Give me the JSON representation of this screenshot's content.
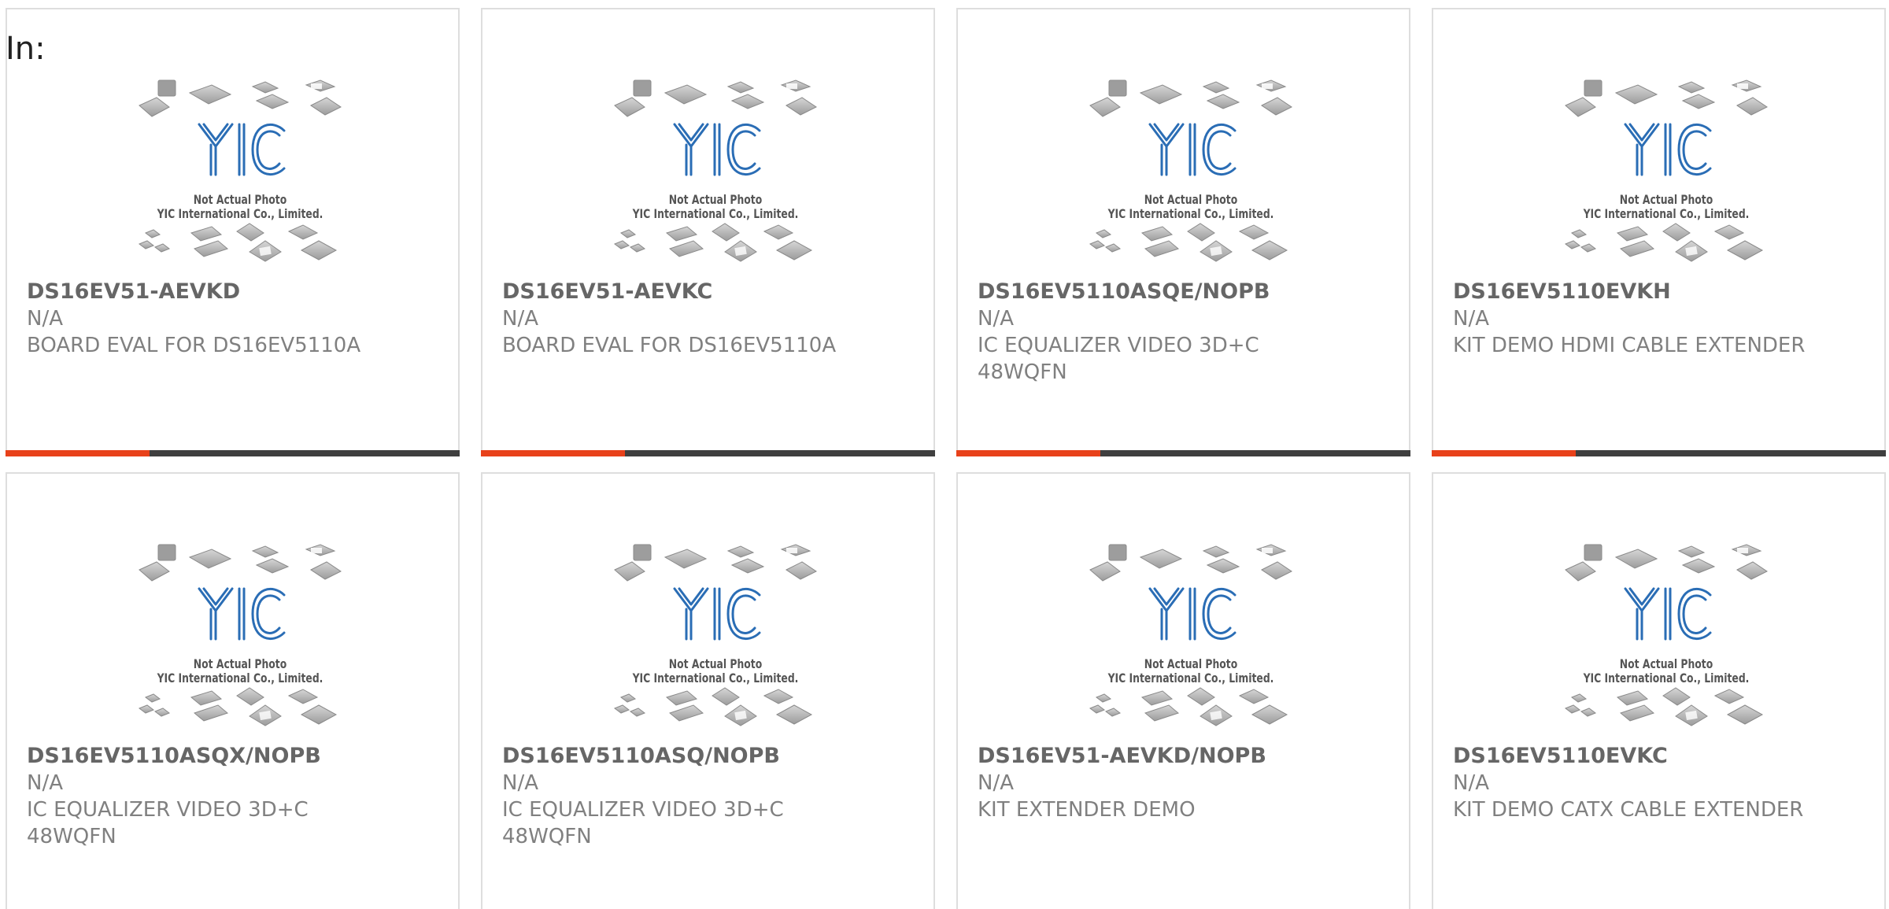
{
  "filter_label": "In:",
  "thumbnail": {
    "caption_line1": "Not Actual Photo",
    "caption_line2": "YIC International Co., Limited.",
    "logo_text": "YIC",
    "logo_color": "#2a6db5"
  },
  "colors": {
    "accent": "#e8411a",
    "bar": "#3f3f3f",
    "border": "#dedede"
  },
  "products": [
    {
      "part": "DS16EV51-AEVKD",
      "manufacturer": "N/A",
      "description": "BOARD EVAL FOR DS16EV5110A"
    },
    {
      "part": "DS16EV51-AEVKC",
      "manufacturer": "N/A",
      "description": "BOARD EVAL FOR DS16EV5110A"
    },
    {
      "part": "DS16EV5110ASQE/NOPB",
      "manufacturer": "N/A",
      "description": "IC EQUALIZER VIDEO 3D+C 48WQFN"
    },
    {
      "part": "DS16EV5110EVKH",
      "manufacturer": "N/A",
      "description": "KIT DEMO HDMI CABLE EXTENDER"
    },
    {
      "part": "DS16EV5110ASQX/NOPB",
      "manufacturer": "N/A",
      "description": "IC EQUALIZER VIDEO 3D+C 48WQFN"
    },
    {
      "part": "DS16EV5110ASQ/NOPB",
      "manufacturer": "N/A",
      "description": "IC EQUALIZER VIDEO 3D+C 48WQFN"
    },
    {
      "part": "DS16EV51-AEVKD/NOPB",
      "manufacturer": "N/A",
      "description": "KIT EXTENDER DEMO"
    },
    {
      "part": "DS16EV5110EVKC",
      "manufacturer": "N/A",
      "description": "KIT DEMO CATX CABLE EXTENDER"
    }
  ]
}
